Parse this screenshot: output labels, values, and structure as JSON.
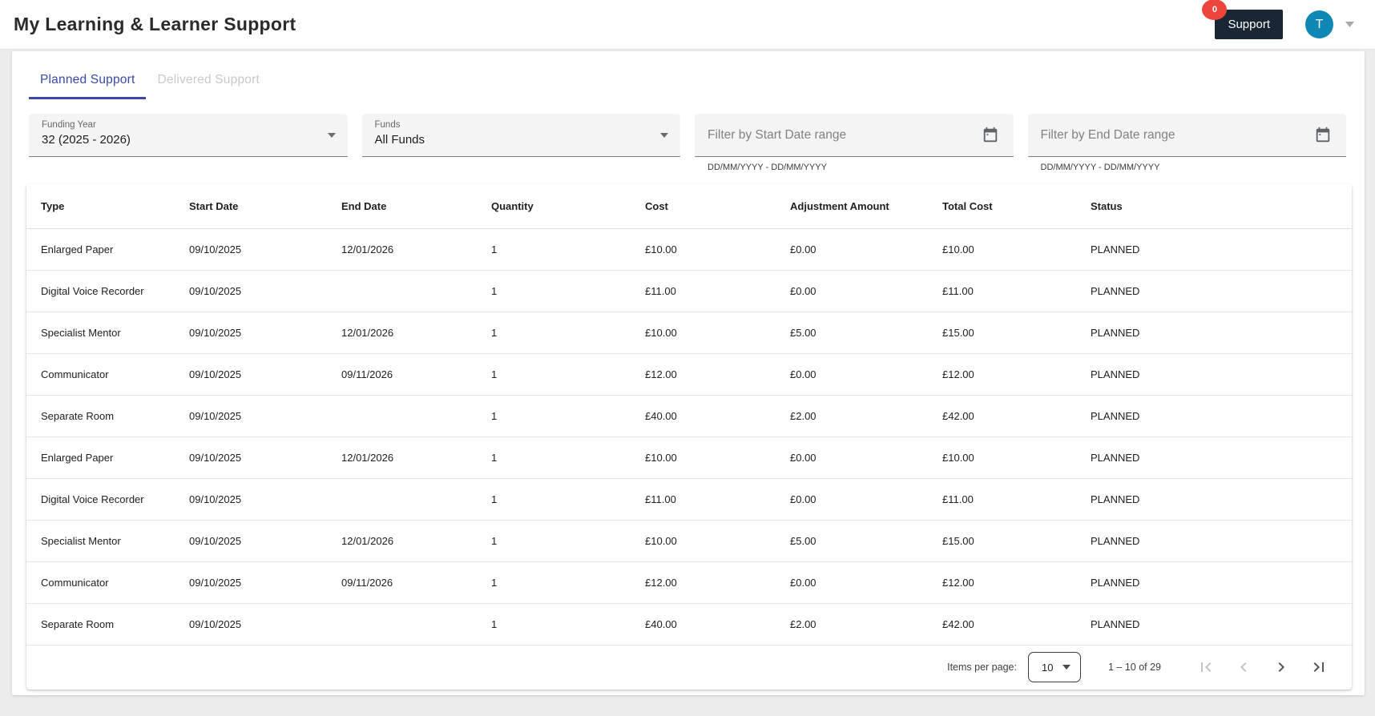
{
  "header": {
    "title": "My Learning & Learner Support",
    "support_badge": "0",
    "support_label": "Support",
    "avatar_initial": "T"
  },
  "tabs": [
    {
      "label": "Planned Support",
      "active": true
    },
    {
      "label": "Delivered Support",
      "active": false
    }
  ],
  "filters": {
    "funding_year": {
      "label": "Funding Year",
      "value": "32 (2025 - 2026)"
    },
    "funds": {
      "label": "Funds",
      "value": "All Funds"
    },
    "start_date": {
      "placeholder": "Filter by Start Date range",
      "hint": "DD/MM/YYYY - DD/MM/YYYY"
    },
    "end_date": {
      "placeholder": "Filter by End Date range",
      "hint": "DD/MM/YYYY - DD/MM/YYYY"
    }
  },
  "table": {
    "columns": [
      "Type",
      "Start Date",
      "End Date",
      "Quantity",
      "Cost",
      "Adjustment Amount",
      "Total Cost",
      "Status"
    ],
    "rows": [
      [
        "Enlarged Paper",
        "09/10/2025",
        "12/01/2026",
        "1",
        "£10.00",
        "£0.00",
        "£10.00",
        "PLANNED"
      ],
      [
        "Digital Voice Recorder",
        "09/10/2025",
        "",
        "1",
        "£11.00",
        "£0.00",
        "£11.00",
        "PLANNED"
      ],
      [
        "Specialist Mentor",
        "09/10/2025",
        "12/01/2026",
        "1",
        "£10.00",
        "£5.00",
        "£15.00",
        "PLANNED"
      ],
      [
        "Communicator",
        "09/10/2025",
        "09/11/2026",
        "1",
        "£12.00",
        "£0.00",
        "£12.00",
        "PLANNED"
      ],
      [
        "Separate Room",
        "09/10/2025",
        "",
        "1",
        "£40.00",
        "£2.00",
        "£42.00",
        "PLANNED"
      ],
      [
        "Enlarged Paper",
        "09/10/2025",
        "12/01/2026",
        "1",
        "£10.00",
        "£0.00",
        "£10.00",
        "PLANNED"
      ],
      [
        "Digital Voice Recorder",
        "09/10/2025",
        "",
        "1",
        "£11.00",
        "£0.00",
        "£11.00",
        "PLANNED"
      ],
      [
        "Specialist Mentor",
        "09/10/2025",
        "12/01/2026",
        "1",
        "£10.00",
        "£5.00",
        "£15.00",
        "PLANNED"
      ],
      [
        "Communicator",
        "09/10/2025",
        "09/11/2026",
        "1",
        "£12.00",
        "£0.00",
        "£12.00",
        "PLANNED"
      ],
      [
        "Separate Room",
        "09/10/2025",
        "",
        "1",
        "£40.00",
        "£2.00",
        "£42.00",
        "PLANNED"
      ]
    ]
  },
  "pagination": {
    "items_per_page_label": "Items per page:",
    "page_size": "10",
    "range_label": "1 – 10 of 29"
  },
  "colors": {
    "accent_indigo": "#3949ab",
    "support_button_bg": "#192633",
    "badge_red": "#ef443b",
    "avatar_teal": "#0f87b5",
    "page_background": "#ececec"
  }
}
